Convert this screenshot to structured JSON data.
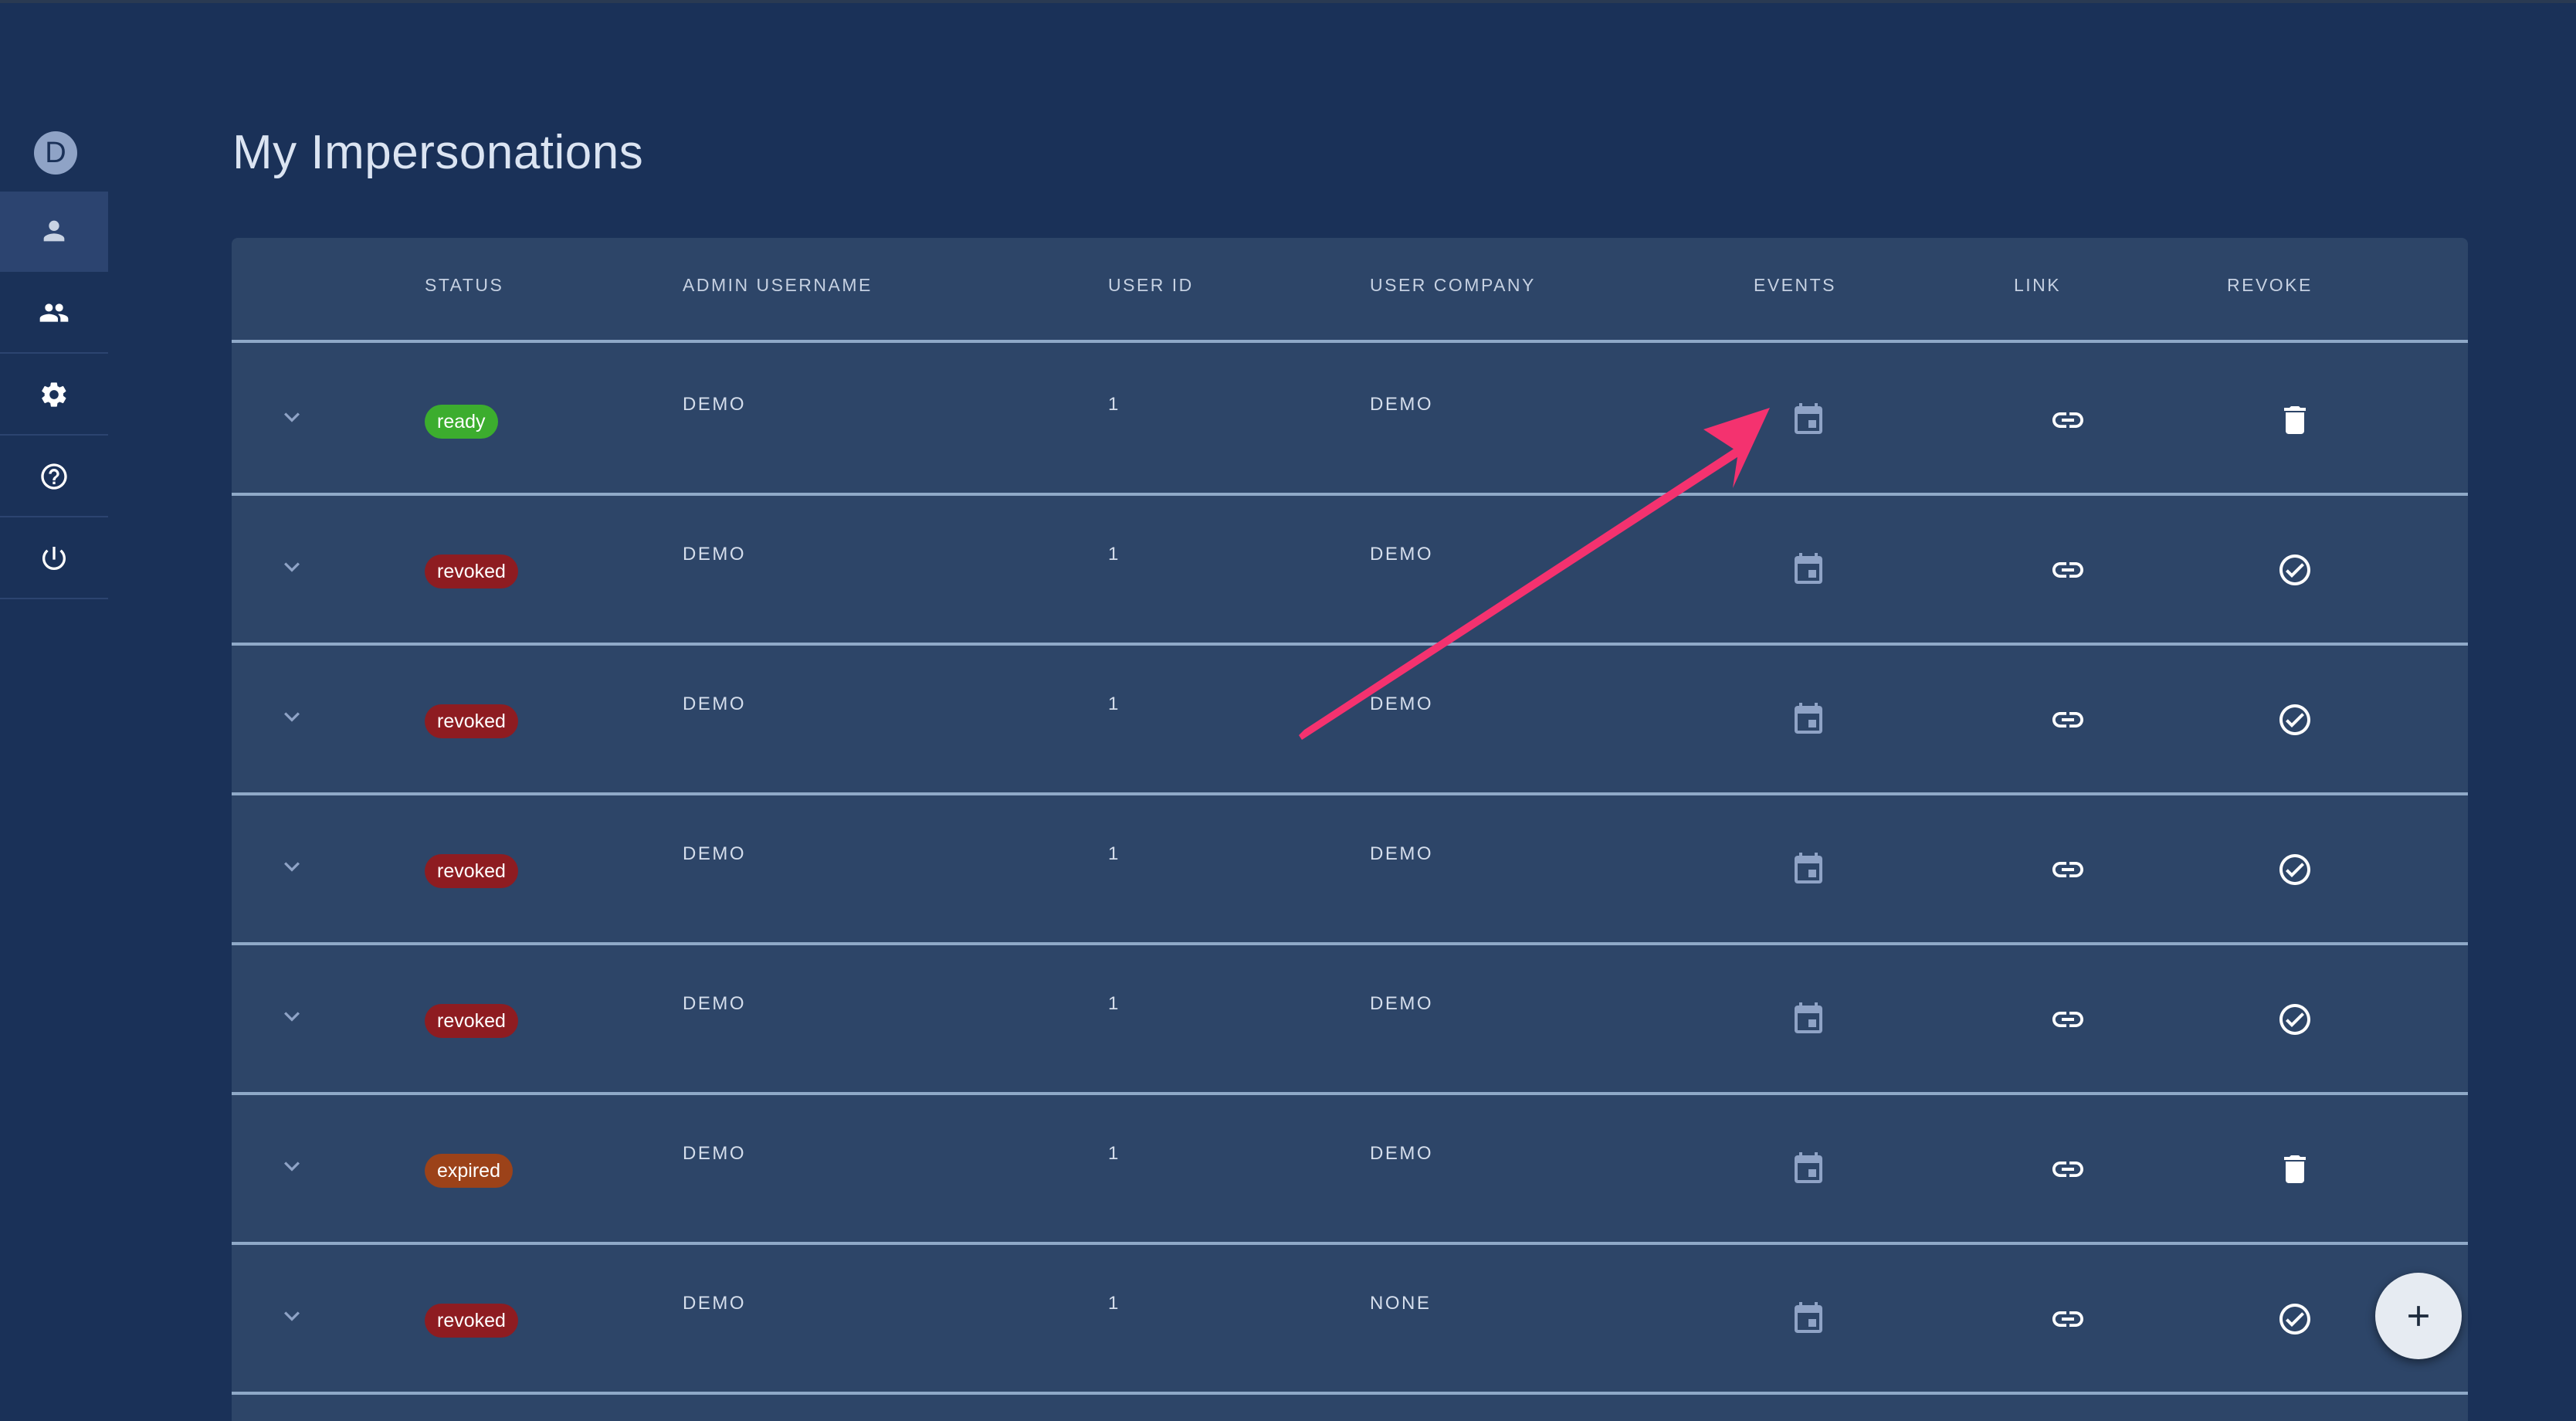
{
  "sidebar": {
    "avatar_letter": "D",
    "items": [
      {
        "icon": "person-icon",
        "active": true
      },
      {
        "icon": "group-icon",
        "active": false
      },
      {
        "icon": "gear-icon",
        "active": false
      },
      {
        "icon": "help-icon",
        "active": false
      },
      {
        "icon": "power-icon",
        "active": false
      }
    ]
  },
  "page": {
    "title": "My Impersonations"
  },
  "table": {
    "columns": {
      "status": "STATUS",
      "admin_username": "ADMIN USERNAME",
      "user_id": "USER ID",
      "user_company": "USER COMPANY",
      "events": "EVENTS",
      "link": "LINK",
      "revoke": "REVOKE"
    },
    "rows": [
      {
        "status": "ready",
        "status_color": "#3cad2e",
        "admin": "DEMO",
        "user_id": "1",
        "company": "DEMO",
        "revoke_icon": "trash-icon"
      },
      {
        "status": "revoked",
        "status_color": "#8e1c21",
        "admin": "DEMO",
        "user_id": "1",
        "company": "DEMO",
        "revoke_icon": "check-circle-icon"
      },
      {
        "status": "revoked",
        "status_color": "#8e1c21",
        "admin": "DEMO",
        "user_id": "1",
        "company": "DEMO",
        "revoke_icon": "check-circle-icon"
      },
      {
        "status": "revoked",
        "status_color": "#8e1c21",
        "admin": "DEMO",
        "user_id": "1",
        "company": "DEMO",
        "revoke_icon": "check-circle-icon"
      },
      {
        "status": "revoked",
        "status_color": "#8e1c21",
        "admin": "DEMO",
        "user_id": "1",
        "company": "DEMO",
        "revoke_icon": "check-circle-icon"
      },
      {
        "status": "expired",
        "status_color": "#9c4219",
        "admin": "DEMO",
        "user_id": "1",
        "company": "DEMO",
        "revoke_icon": "trash-icon"
      },
      {
        "status": "revoked",
        "status_color": "#8e1c21",
        "admin": "DEMO",
        "user_id": "1",
        "company": "NONE",
        "revoke_icon": "check-circle-icon"
      }
    ]
  },
  "fab": {
    "icon": "plus-icon"
  },
  "colors": {
    "background": "#1a3158",
    "table": "#2d4568",
    "divider": "#8fa9c8",
    "annotation_arrow": "#f4326f"
  }
}
